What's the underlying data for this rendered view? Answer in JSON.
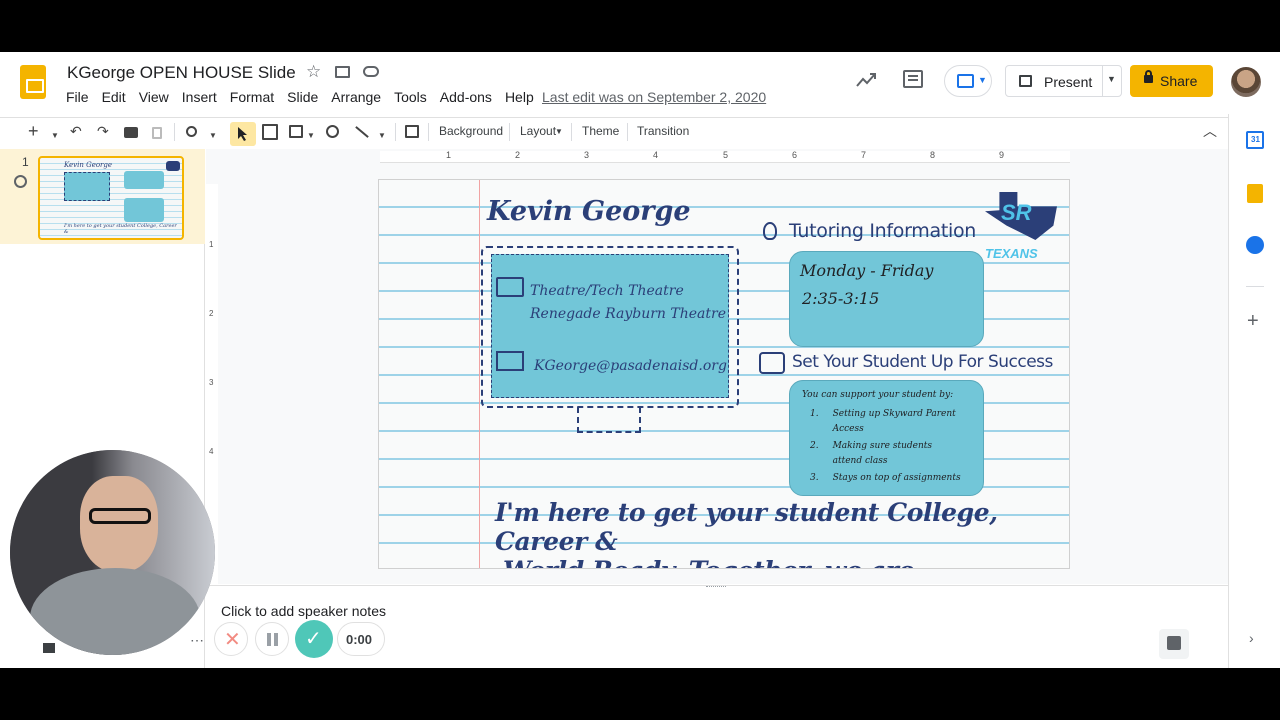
{
  "header": {
    "doc_title": "KGeorge OPEN HOUSE Slide",
    "menu": [
      "File",
      "Edit",
      "View",
      "Insert",
      "Format",
      "Slide",
      "Arrange",
      "Tools",
      "Add-ons",
      "Help"
    ],
    "last_edit": "Last edit was on September 2, 2020",
    "present_label": "Present",
    "share_label": "Share"
  },
  "toolbar": {
    "background_label": "Background",
    "layout_label": "Layout",
    "theme_label": "Theme",
    "transition_label": "Transition"
  },
  "filmstrip": {
    "slide_number": "1"
  },
  "ruler": {
    "h_marks": [
      "1",
      "2",
      "3",
      "4",
      "5",
      "6",
      "7",
      "8",
      "9"
    ],
    "v_marks": [
      "1",
      "2",
      "3",
      "4"
    ]
  },
  "slide": {
    "name": "Kevin George",
    "theatre_line1": "Theatre/Tech Theatre",
    "theatre_line2": "Renegade Rayburn Theatre",
    "email": "KGeorge@pasadenaisd.org",
    "tutoring_heading": "Tutoring Information",
    "tutoring_days": "Monday - Friday",
    "tutoring_time": "2:35-3:15",
    "success_heading": "Set Your Student Up For Success",
    "support_intro": "You can support your student by:",
    "support_items": [
      "Setting up Skyward Parent Access",
      "Making sure students attend class",
      "Stays on top of assignments"
    ],
    "logo_text": "SR",
    "logo_sub": "TEXANS",
    "closing_line1": "I'm here to get your student College, Career &",
    "closing_line2": "World Ready. Together, we are #TexanTough!"
  },
  "notes": {
    "placeholder": "Click to add speaker notes"
  },
  "recorder": {
    "timer": "0:00"
  },
  "colors": {
    "accent_yellow": "#f4b400",
    "card_blue": "#72c6d8",
    "text_navy": "#2b3f78",
    "ruled_line": "#9ed3e8",
    "record_teal": "#4fc7b8"
  }
}
